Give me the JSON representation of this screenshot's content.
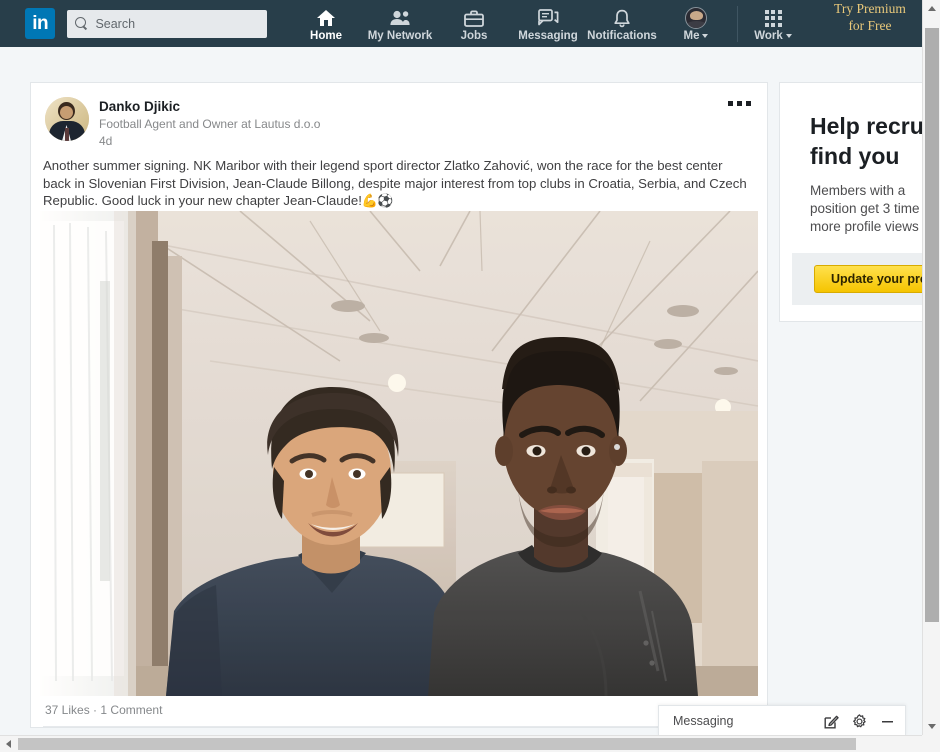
{
  "nav": {
    "logo_text": "in",
    "logo_name": "linkedin-logo",
    "search": {
      "placeholder": "Search",
      "value": "",
      "icon": "search-icon"
    },
    "items": [
      {
        "label": "Home",
        "icon": "home-icon",
        "active": true
      },
      {
        "label": "My Network",
        "icon": "people-icon",
        "active": false
      },
      {
        "label": "Jobs",
        "icon": "briefcase-icon",
        "active": false
      },
      {
        "label": "Messaging",
        "icon": "speech-bubbles-icon",
        "active": false
      },
      {
        "label": "Notifications",
        "icon": "bell-icon",
        "active": false
      },
      {
        "label": "Me",
        "icon": "avatar-icon",
        "active": false,
        "has_caret": true
      }
    ],
    "work": {
      "label": "Work",
      "icon": "grid-icon",
      "has_caret": true
    },
    "premium": {
      "line1": "Try Premium",
      "line2": "for Free"
    },
    "colors": {
      "navbar_bg": "#283e4a",
      "logo_bg": "#0077b5",
      "premium_text": "#e8c87a"
    }
  },
  "post": {
    "author": "Danko Djikic",
    "headline": "Football Agent and Owner at Lautus d.o.o",
    "time": "4d",
    "menu_icon": "overflow-menu-icon",
    "avatar_name": "author-avatar",
    "text_line1": "Another summer signing. NK Maribor with their legend sport director Zlatko Zahović, won the race for the best center",
    "text_line2": "back in Slovenian First Division, Jean-Claude Billong, despite major interest from top clubs in Croatia, Serbia, and Czech",
    "text_line3": "Republic. Good luck in your new chapter Jean-Claude!",
    "text_emoji": "💪⚽",
    "image_alt": "two-men-posing-indoors-photo",
    "likes": "37 Likes",
    "separator": "·",
    "comments": "1 Comment"
  },
  "ad": {
    "title_line1": "Help recrui",
    "title_line2": "find you",
    "body_line1": "Members with a",
    "body_line2": "position get 3 time",
    "body_line3": "more profile views",
    "button_label": "Update your prof",
    "button_color": "#f5c400"
  },
  "messaging": {
    "title": "Messaging",
    "compose_icon": "compose-icon",
    "settings_icon": "gear-icon",
    "minimize_icon": "minimize-icon"
  },
  "scrollbars": {
    "vertical": {
      "name": "vertical-scrollbar",
      "up": "scroll-up-arrow",
      "down": "scroll-down-arrow"
    },
    "horizontal": {
      "name": "horizontal-scrollbar",
      "left": "scroll-left-arrow",
      "right": "scroll-right-arrow"
    }
  }
}
